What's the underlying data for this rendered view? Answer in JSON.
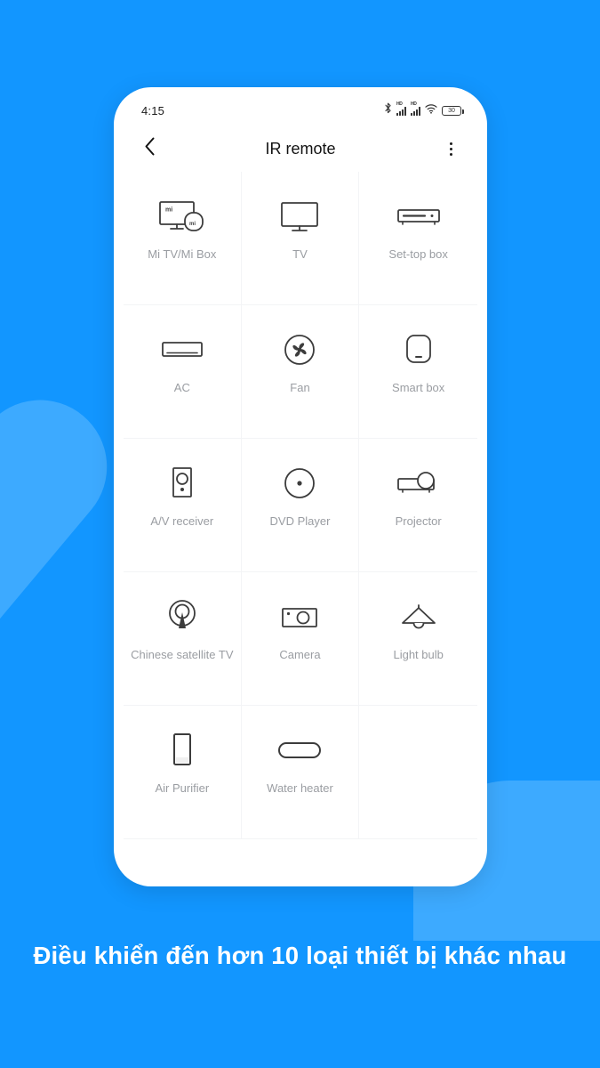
{
  "theme": {
    "background_color": "#1296ff",
    "blob_color": "#45aeff",
    "phone_color": "#ffffff",
    "label_color": "#9a9da2",
    "icon_color": "#3c3c3c",
    "caption_color": "#ffffff"
  },
  "status_bar": {
    "time": "4:15",
    "battery_level": "30",
    "hd_label": "HD",
    "icons": [
      "bluetooth-icon",
      "signal-hd-icon",
      "signal-hd-icon",
      "wifi-icon",
      "battery-icon"
    ]
  },
  "app_bar": {
    "title": "IR remote",
    "back_icon": "chevron-left-icon",
    "overflow_icon": "more-vertical-icon"
  },
  "device_grid": {
    "rows": 5,
    "columns": 3,
    "items": [
      {
        "label": "Mi TV/Mi Box",
        "icon": "mi-tv-box-icon"
      },
      {
        "label": "TV",
        "icon": "tv-icon"
      },
      {
        "label": "Set-top box",
        "icon": "set-top-box-icon"
      },
      {
        "label": "AC",
        "icon": "air-conditioner-icon"
      },
      {
        "label": "Fan",
        "icon": "fan-icon"
      },
      {
        "label": "Smart box",
        "icon": "smart-box-icon"
      },
      {
        "label": "A/V receiver",
        "icon": "av-receiver-icon"
      },
      {
        "label": "DVD Player",
        "icon": "dvd-player-icon"
      },
      {
        "label": "Projector",
        "icon": "projector-icon"
      },
      {
        "label": "Chinese satellite TV",
        "icon": "satellite-dish-icon"
      },
      {
        "label": "Camera",
        "icon": "camera-icon"
      },
      {
        "label": "Light bulb",
        "icon": "light-bulb-icon"
      },
      {
        "label": "Air Purifier",
        "icon": "air-purifier-icon"
      },
      {
        "label": "Water heater",
        "icon": "water-heater-icon"
      },
      {
        "label": "",
        "icon": ""
      }
    ]
  },
  "caption": {
    "text": "Điều khiển đến hơn 10 loại thiết bị khác nhau"
  },
  "mi_logo_text": "mi"
}
